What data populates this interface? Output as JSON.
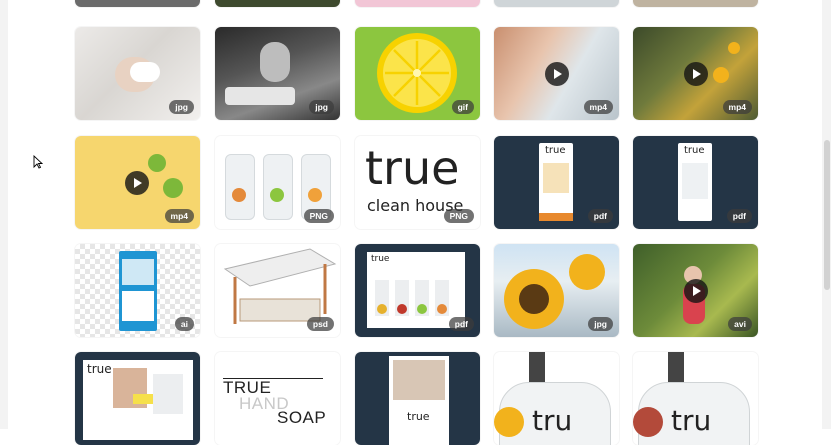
{
  "grid": {
    "row1": [
      {
        "badge": "jpg",
        "icon": "hand-washing-photo"
      },
      {
        "badge": "jpg",
        "icon": "bathroom-sink-photo"
      },
      {
        "badge": "gif",
        "icon": "lemon-slice-graphic"
      },
      {
        "badge": "mp4",
        "icon": "play-icon"
      },
      {
        "badge": "mp4",
        "icon": "play-icon"
      }
    ],
    "row2": [
      {
        "badge": "mp4",
        "icon": "play-icon"
      },
      {
        "badge": "PNG",
        "icon": "spray-bottles-product"
      },
      {
        "badge": "PNG",
        "brand": "true",
        "tagline": "clean house"
      },
      {
        "badge": "pdf",
        "logo": "true"
      },
      {
        "badge": "pdf",
        "logo": "true"
      }
    ],
    "row3": [
      {
        "badge": "ai",
        "icon": "web-mockup"
      },
      {
        "badge": "psd",
        "icon": "booth-mockup"
      },
      {
        "badge": "pdf",
        "logo": "true"
      },
      {
        "badge": "jpg",
        "icon": "sunflowers-photo"
      },
      {
        "badge": "avi",
        "icon": "play-icon"
      }
    ],
    "row4": [
      {
        "logo": "true"
      },
      {
        "line1": "TRUE",
        "line2": "HAND",
        "line3": "SOAP"
      },
      {
        "logo": "true"
      },
      {
        "logo": "tru"
      },
      {
        "logo": "tru"
      }
    ]
  },
  "colors": {
    "navy": "#243546",
    "lemon": "#8cc63f",
    "sand": "#f6d66e"
  }
}
